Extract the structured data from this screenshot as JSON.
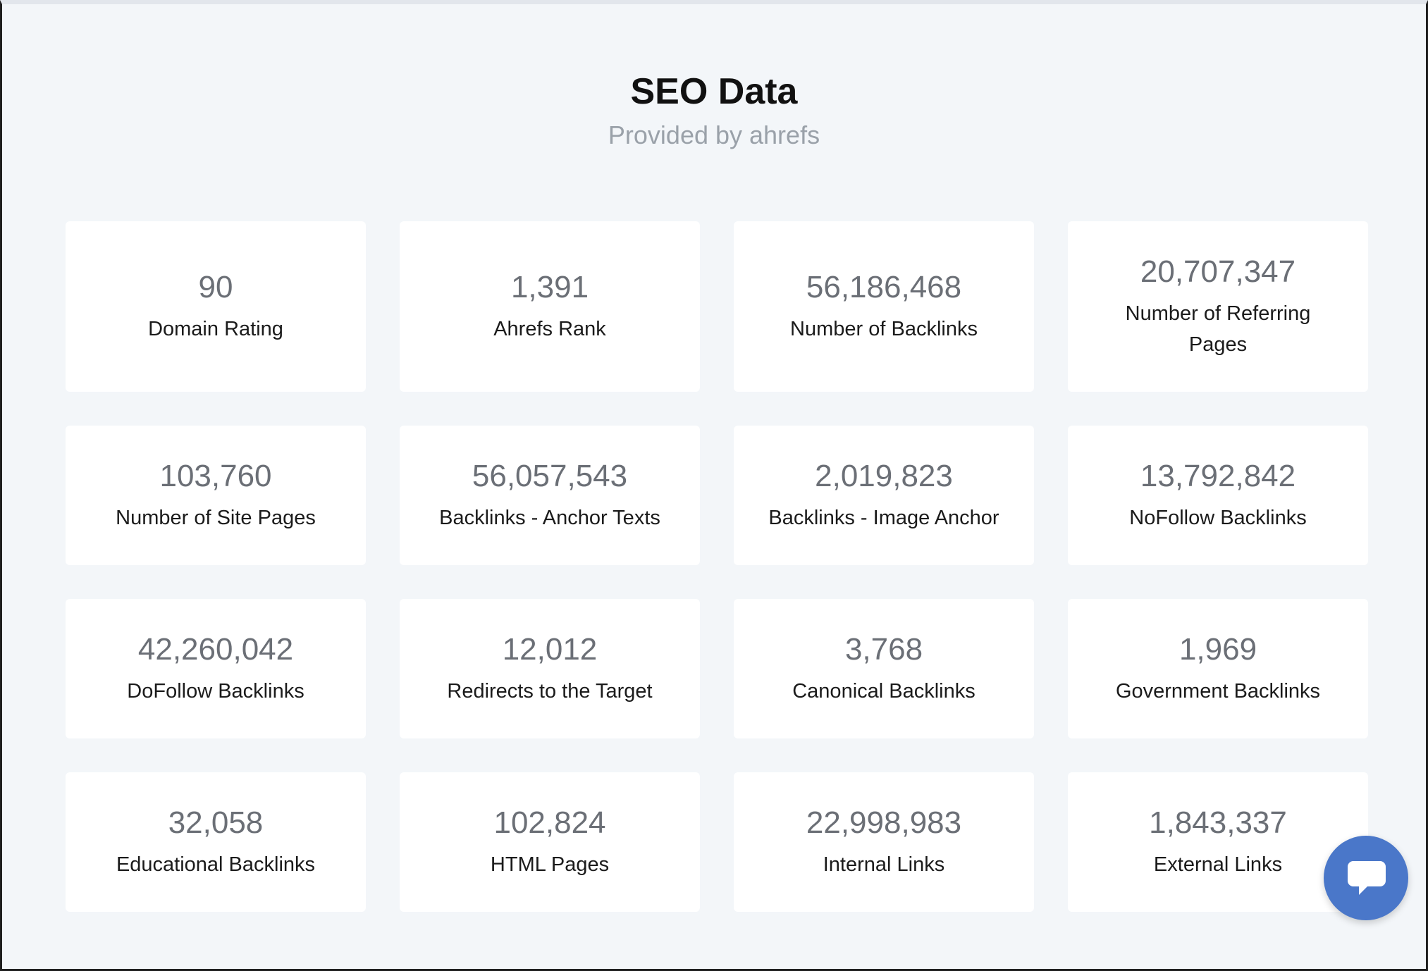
{
  "header": {
    "title": "SEO Data",
    "subtitle": "Provided by ahrefs"
  },
  "metrics": [
    {
      "value": "90",
      "label": "Domain Rating"
    },
    {
      "value": "1,391",
      "label": "Ahrefs Rank"
    },
    {
      "value": "56,186,468",
      "label": "Number of Backlinks"
    },
    {
      "value": "20,707,347",
      "label": "Number of Referring Pages"
    },
    {
      "value": "103,760",
      "label": "Number of Site Pages"
    },
    {
      "value": "56,057,543",
      "label": "Backlinks - Anchor Texts"
    },
    {
      "value": "2,019,823",
      "label": "Backlinks - Image Anchor"
    },
    {
      "value": "13,792,842",
      "label": "NoFollow Backlinks"
    },
    {
      "value": "42,260,042",
      "label": "DoFollow Backlinks"
    },
    {
      "value": "12,012",
      "label": "Redirects to the Target"
    },
    {
      "value": "3,768",
      "label": "Canonical Backlinks"
    },
    {
      "value": "1,969",
      "label": "Government Backlinks"
    },
    {
      "value": "32,058",
      "label": "Educational Backlinks"
    },
    {
      "value": "102,824",
      "label": "HTML Pages"
    },
    {
      "value": "22,998,983",
      "label": "Internal Links"
    },
    {
      "value": "1,843,337",
      "label": "External Links"
    }
  ],
  "chat_widget": {
    "icon": "chat-bubble-icon",
    "color": "#4a77c9"
  }
}
